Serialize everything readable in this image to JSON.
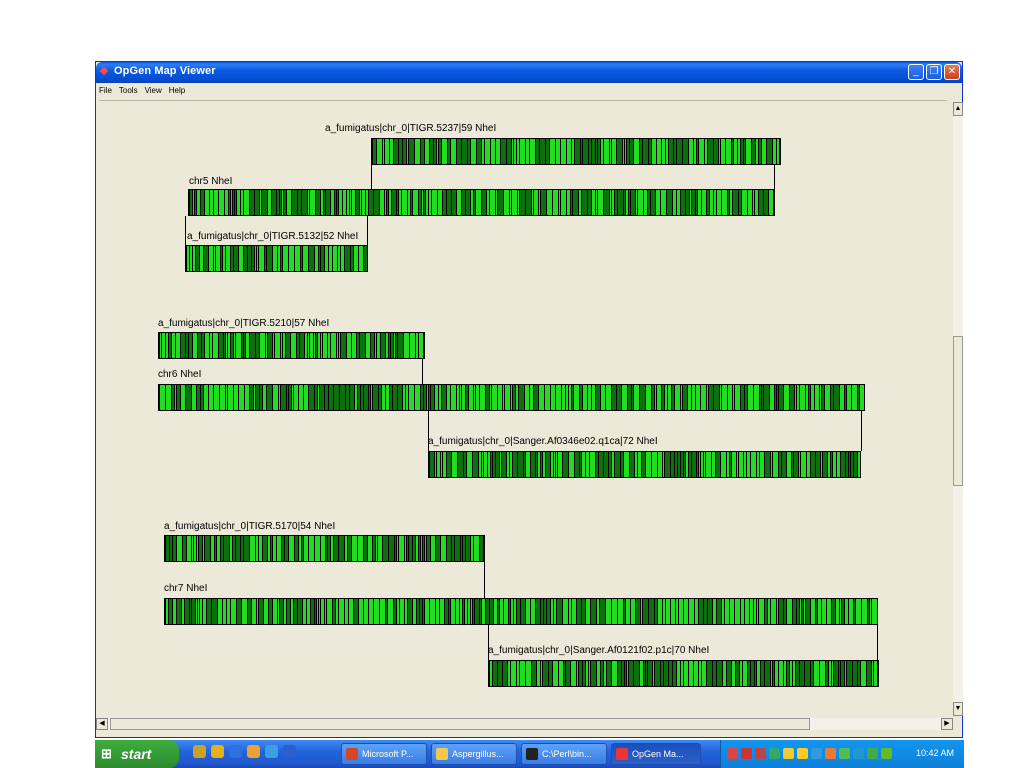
{
  "window": {
    "title": "OpGen Map Viewer",
    "menu": [
      "File",
      "Tools",
      "View",
      "Help"
    ]
  },
  "maps": [
    {
      "id": "a1",
      "label": "a_fumigatus|chr_0|TIGR.5237|59 NheI",
      "kind": "contig",
      "seed": 1
    },
    {
      "id": "c5",
      "label": "chr5 NheI",
      "kind": "chromosome",
      "seed": 2
    },
    {
      "id": "a2",
      "label": "a_fumigatus|chr_0|TIGR.5132|52 NheI",
      "kind": "contig",
      "seed": 3
    },
    {
      "id": "a3",
      "label": "a_fumigatus|chr_0|TIGR.5210|57 NheI",
      "kind": "contig",
      "seed": 4
    },
    {
      "id": "c6",
      "label": "chr6 NheI",
      "kind": "chromosome",
      "seed": 5
    },
    {
      "id": "a4",
      "label": "a_fumigatus|chr_0|Sanger.Af0346e02.q1ca|72 NheI",
      "kind": "contig",
      "seed": 6
    },
    {
      "id": "a5",
      "label": "a_fumigatus|chr_0|TIGR.5170|54 NheI",
      "kind": "contig",
      "seed": 7
    },
    {
      "id": "c7",
      "label": "chr7 NheI",
      "kind": "chromosome",
      "seed": 8
    },
    {
      "id": "a6",
      "label": "a_fumigatus|chr_0|Sanger.Af0121f02.p1c|70 NheI",
      "kind": "contig",
      "seed": 9
    }
  ],
  "colors": {
    "fragment_light": "#22dd22",
    "fragment_dark": "#0d6f0d",
    "cut": "#000000"
  },
  "taskbar": {
    "start_label": "start",
    "quicklaunch": [
      "ql-icon-1",
      "ql-icon-2",
      "ql-icon-3",
      "ql-icon-4",
      "ql-icon-5",
      "ql-icon-6"
    ],
    "items": [
      {
        "label": "Microsoft P...",
        "icon": "powerpoint-icon",
        "color": "#d24726"
      },
      {
        "label": "Aspergillus...",
        "icon": "folder-icon",
        "color": "#f2c94c"
      },
      {
        "label": "C:\\Perl\\bin...",
        "icon": "console-icon",
        "color": "#222"
      },
      {
        "label": "OpGen Ma...",
        "icon": "opgen-icon",
        "color": "#e33"
      }
    ],
    "clock": "10:42 AM"
  }
}
